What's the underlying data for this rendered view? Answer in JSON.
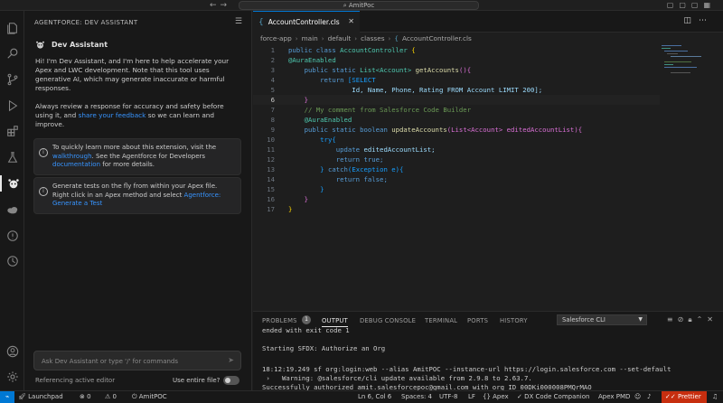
{
  "titlebar": {
    "search_text": "AmitPoc"
  },
  "sidebar": {
    "header": "AGENTFORCE: DEV ASSISTANT",
    "assistant_name": "Dev Assistant",
    "intro": "Hi! I'm Dev Assistant, and I'm here to help accelerate your Apex and LWC development. Note that this tool uses generative AI, which may generate inaccurate or harmful responses.",
    "review_before": "Always review a response for accuracy and safety before using it, and ",
    "review_link": "share your feedback",
    "review_after": " so we can learn and improve.",
    "card1_before": "To quickly learn more about this extension, visit the ",
    "card1_link1": "walkthrough",
    "card1_middle": ". See the Agentforce for Developers ",
    "card1_link2": "documentation",
    "card1_after": " for more details.",
    "card2_text": "Generate tests on the fly from within your Apex file. Right click in an Apex method and select ",
    "card2_link": "Agentforce: Generate a Test",
    "chat_placeholder": "Ask Dev Assistant or type '/' for commands",
    "ref_label": "Referencing active editor",
    "entire_file_label": "Use entire file?"
  },
  "editor": {
    "tab_label": "AccountController.cls",
    "breadcrumb": [
      "force-app",
      "main",
      "default",
      "classes",
      "AccountController.cls"
    ],
    "current_line": 6,
    "lines": [
      {
        "n": "1"
      },
      {
        "n": "2"
      },
      {
        "n": "3"
      },
      {
        "n": "4"
      },
      {
        "n": "5"
      },
      {
        "n": "6"
      },
      {
        "n": "7"
      },
      {
        "n": "8"
      },
      {
        "n": "9"
      },
      {
        "n": "10"
      },
      {
        "n": "11"
      },
      {
        "n": "12"
      },
      {
        "n": "13"
      },
      {
        "n": "14"
      },
      {
        "n": "15"
      },
      {
        "n": "16"
      },
      {
        "n": "17"
      }
    ],
    "code": {
      "l1_kw": "public class ",
      "l1_cls": "AccountController",
      "l1_brace": " {",
      "l2": "@AuraEnabled",
      "l3_kw": "public static ",
      "l3_type": "List",
      "l3_gen": "<Account>",
      "l3_fn": " getAccounts",
      "l3_rest": "(){",
      "l4_kw": "return ",
      "l4_rest": "[SELECT",
      "l5": "Id, Name, Phone, Rating FROM Account LIMIT 200];",
      "l6": "}",
      "l7": "// My comment from Salesforce Code Builder",
      "l8": "@AuraEnabled",
      "l9_kw": "public static boolean ",
      "l9_fn": "updateAccounts",
      "l9_rest": "(List<Account> editedAccountList){",
      "l10": "try{",
      "l11_kw": "update ",
      "l11_rest": "editedAccountList;",
      "l12_kw": "return ",
      "l12_rest": "true;",
      "l13_brace": "} ",
      "l13_kw": "catch",
      "l13_rest": "(Exception e){",
      "l14_kw": "return ",
      "l14_rest": "false;",
      "l15": "}",
      "l16": "}",
      "l17": "}"
    }
  },
  "panel": {
    "tabs": [
      "PROBLEMS",
      "OUTPUT",
      "DEBUG CONSOLE",
      "TERMINAL",
      "PORTS",
      "HISTORY"
    ],
    "problems_count": "1",
    "output_channel": "Salesforce CLI",
    "lines": [
      "ended with exit code 1",
      "",
      "Starting SFDX: Authorize an Org",
      "",
      "18:12:19.249 sf org:login:web --alias AmitPOC --instance-url https://login.salesforce.com --set-default",
      " ›   Warning: @salesforce/cli update available from 2.9.8 to 2.63.7.",
      "Successfully authorized amit.salesforcepoc@gmail.com with org ID 00DKi000008PMQrMAO"
    ]
  },
  "statusbar": {
    "launchpad": "Launchpad",
    "sync_count": "0",
    "warn_count": "0",
    "org": "AmitPOC",
    "position": "Ln 6, Col 6",
    "spaces": "Spaces: 4",
    "encoding": "UTF-8",
    "eol": "LF",
    "language": "Apex",
    "companion": "DX Code Companion",
    "pmd": "Apex PMD",
    "prettier": "Prettier"
  },
  "colors": {
    "accent": "#0078d4",
    "prettier": "#c72e0f",
    "link": "#3794ff"
  }
}
